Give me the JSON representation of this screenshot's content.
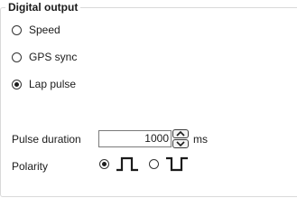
{
  "group": {
    "title": "Digital output"
  },
  "output_mode": {
    "options": [
      {
        "label": "Speed",
        "selected": false
      },
      {
        "label": "GPS sync",
        "selected": false
      },
      {
        "label": "Lap pulse",
        "selected": true
      }
    ]
  },
  "pulse_duration": {
    "label": "Pulse duration",
    "value": "1000",
    "unit": "ms"
  },
  "polarity": {
    "label": "Polarity",
    "options": [
      {
        "icon": "positive-pulse-icon",
        "selected": true
      },
      {
        "icon": "negative-pulse-icon",
        "selected": false
      }
    ]
  },
  "icons": {
    "spin_up": "chevron-up-icon",
    "spin_down": "chevron-down-icon"
  },
  "colors": {
    "border": "#d9d9d9",
    "text": "#1b1b1b",
    "control_border": "#7a7a7a"
  }
}
